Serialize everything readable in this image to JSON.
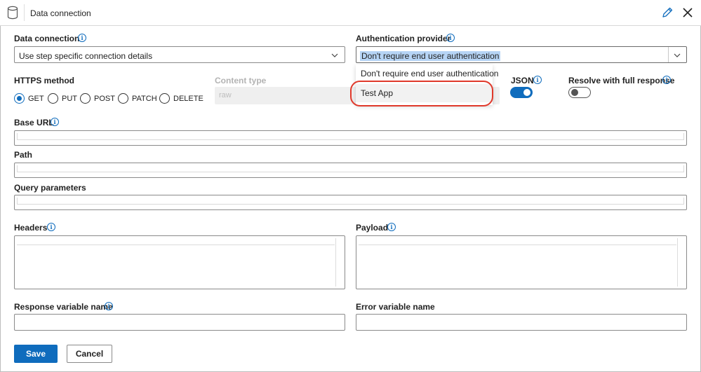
{
  "header": {
    "title": "Data connection",
    "icons": {
      "db": "database-icon",
      "edit": "pencil-icon",
      "close": "close-icon"
    }
  },
  "data_connection": {
    "label": "Data connection",
    "value": "Use step specific connection details"
  },
  "auth_provider": {
    "label": "Authentication provider",
    "value": "Don't require end user authentication",
    "options": [
      "Don't require end user authentication",
      "Test App"
    ]
  },
  "https_method": {
    "label": "HTTPS method",
    "options": [
      "GET",
      "PUT",
      "POST",
      "PATCH",
      "DELETE"
    ],
    "selected": "GET"
  },
  "content_type": {
    "label": "Content type",
    "value": "raw"
  },
  "json": {
    "label": "JSON",
    "on": true
  },
  "resolve": {
    "label": "Resolve with full response",
    "on": false
  },
  "base_url": {
    "label": "Base URL"
  },
  "path": {
    "label": "Path"
  },
  "query": {
    "label": "Query parameters"
  },
  "headers": {
    "label": "Headers"
  },
  "payload": {
    "label": "Payload"
  },
  "response_var": {
    "label": "Response variable name"
  },
  "error_var": {
    "label": "Error variable name"
  },
  "buttons": {
    "save": "Save",
    "cancel": "Cancel"
  },
  "colors": {
    "accent": "#0f6cbd",
    "highlight_ring": "#e0392b"
  }
}
